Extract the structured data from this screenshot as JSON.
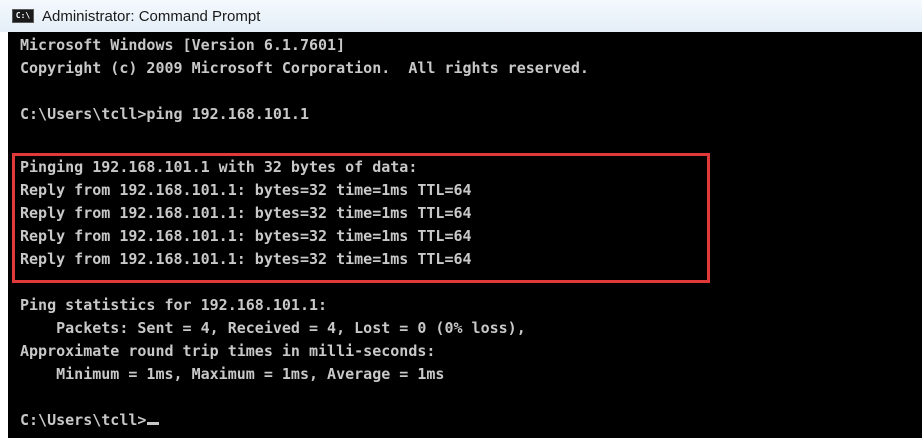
{
  "window": {
    "title": "Administrator: Command Prompt",
    "icon": "cmd-icon",
    "icon_text": "C:\\"
  },
  "console": {
    "background": "#000000",
    "text_color": "#c8c8c8",
    "lines": [
      "Microsoft Windows [Version 6.1.7601]",
      "Copyright (c) 2009 Microsoft Corporation.  All rights reserved.",
      "",
      "C:\\Users\\tcll>ping 192.168.101.1",
      "",
      "Pinging 192.168.101.1 with 32 bytes of data:",
      "Reply from 192.168.101.1: bytes=32 time=1ms TTL=64",
      "Reply from 192.168.101.1: bytes=32 time=1ms TTL=64",
      "Reply from 192.168.101.1: bytes=32 time=1ms TTL=64",
      "Reply from 192.168.101.1: bytes=32 time=1ms TTL=64",
      "",
      "Ping statistics for 192.168.101.1:",
      "    Packets: Sent = 4, Received = 4, Lost = 0 (0% loss),",
      "Approximate round trip times in milli-seconds:",
      "    Minimum = 1ms, Maximum = 1ms, Average = 1ms",
      "",
      "C:\\Users\\tcll>"
    ]
  },
  "annotation": {
    "highlight_color": "#e0393a"
  }
}
